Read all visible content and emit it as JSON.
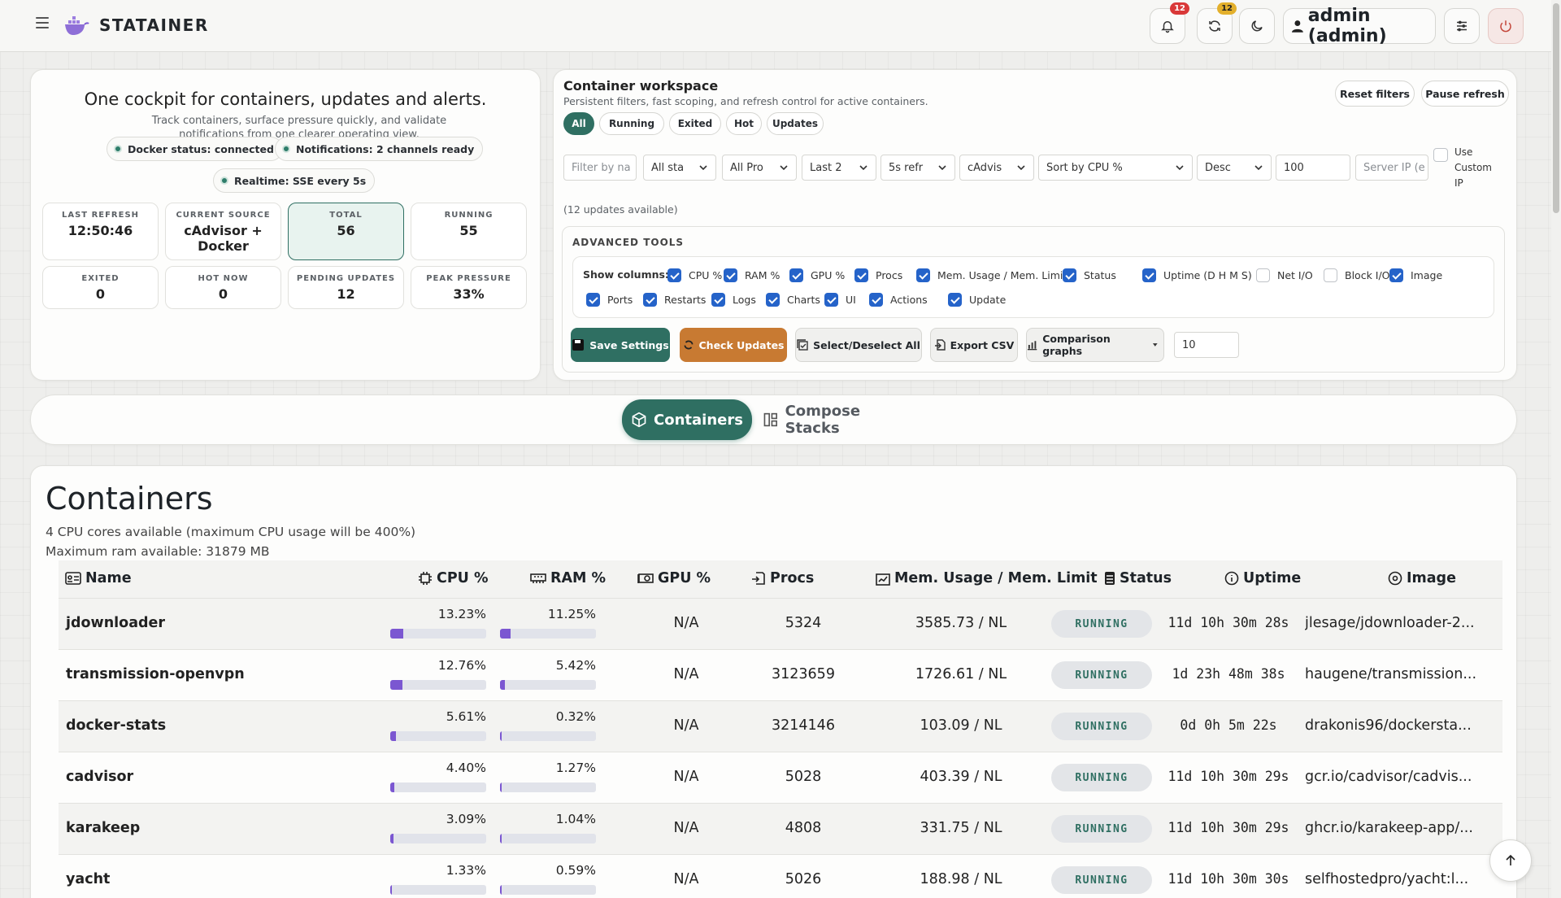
{
  "app": {
    "brand": "STATAINER",
    "notifications_count": "12",
    "updates_count": "12",
    "user_label": "admin (admin)"
  },
  "hero": {
    "title": "One cockpit for containers, updates and alerts.",
    "subtitle": "Track containers, surface pressure quickly, and validate notifications from one clearer operating view.",
    "pills": [
      "Docker status: connected",
      "Notifications: 2 channels ready",
      "Realtime: SSE every 5s"
    ],
    "stats": [
      {
        "label": "LAST REFRESH",
        "value": "12:50:46"
      },
      {
        "label": "CURRENT SOURCE",
        "value": "cAdvisor + Docker"
      },
      {
        "label": "TOTAL",
        "value": "56"
      },
      {
        "label": "RUNNING",
        "value": "55"
      },
      {
        "label": "EXITED",
        "value": "0"
      },
      {
        "label": "HOT NOW",
        "value": "0"
      },
      {
        "label": "PENDING UPDATES",
        "value": "12"
      },
      {
        "label": "PEAK PRESSURE",
        "value": "33%"
      }
    ]
  },
  "workspace": {
    "title": "Container workspace",
    "subtitle": "Persistent filters, fast scoping, and refresh control for active containers.",
    "reset_label": "Reset filters",
    "pause_label": "Pause refresh",
    "tabs": [
      "All",
      "Running",
      "Exited",
      "Hot",
      "Updates"
    ],
    "filter_placeholder": "Filter by na",
    "status_select": "All sta",
    "project_select": "All Pro",
    "time_select": "Last 2",
    "refresh_select": "5s refr",
    "source_select": "cAdvis",
    "sort_select": "Sort by CPU %",
    "order_select": "Desc",
    "limit_value": "100",
    "server_ip_placeholder": "Server IP (e",
    "custom_ip_label": "Use Custom IP",
    "updates_note": "(12 updates available)"
  },
  "advanced": {
    "title": "ADVANCED TOOLS",
    "show_columns_label": "Show columns:",
    "columns_row1": [
      {
        "label": "CPU %",
        "checked": true
      },
      {
        "label": "RAM %",
        "checked": true
      },
      {
        "label": "GPU %",
        "checked": true
      },
      {
        "label": "Procs",
        "checked": true
      },
      {
        "label": "Mem. Usage / Mem. Limit",
        "checked": true
      },
      {
        "label": "Status",
        "checked": true
      },
      {
        "label": "Uptime (D H M S)",
        "checked": true
      },
      {
        "label": "Net I/O",
        "checked": false
      },
      {
        "label": "Block I/O",
        "checked": false
      },
      {
        "label": "Image",
        "checked": true
      }
    ],
    "columns_row2": [
      {
        "label": "Ports",
        "checked": true
      },
      {
        "label": "Restarts",
        "checked": true
      },
      {
        "label": "Logs",
        "checked": true
      },
      {
        "label": "Charts",
        "checked": true
      },
      {
        "label": "UI",
        "checked": true
      },
      {
        "label": "Actions",
        "checked": true
      },
      {
        "label": "Update",
        "checked": true
      }
    ],
    "save_label": "Save Settings",
    "check_updates_label": "Check Updates",
    "select_all_label": "Select/Deselect All",
    "export_label": "Export CSV",
    "comparison_label": "Comparison graphs",
    "comparison_value": "10"
  },
  "switcher": {
    "containers_label": "Containers",
    "stacks_label": "Compose Stacks"
  },
  "containers": {
    "title": "Containers",
    "cpu_note": "4 CPU cores available (maximum CPU usage will be 400%)",
    "ram_note": "Maximum ram available: 31879 MB",
    "headers": [
      "Name",
      "CPU %",
      "RAM %",
      "GPU %",
      "Procs",
      "Mem. Usage / Mem. Limit",
      "Status",
      "Uptime",
      "Image"
    ],
    "rows": [
      {
        "name": "jdownloader",
        "cpu": "13.23%",
        "cpu_val": 13.23,
        "ram": "11.25%",
        "ram_val": 11.25,
        "gpu": "N/A",
        "procs": "5324",
        "mem": "3585.73 / NL",
        "status": "RUNNING",
        "uptime": "11d 10h 30m 28s",
        "image": "jlesage/jdownloader-2..."
      },
      {
        "name": "transmission-openvpn",
        "cpu": "12.76%",
        "cpu_val": 12.76,
        "ram": "5.42%",
        "ram_val": 5.42,
        "gpu": "N/A",
        "procs": "3123659",
        "mem": "1726.61 / NL",
        "status": "RUNNING",
        "uptime": "1d 23h 48m 38s",
        "image": "haugene/transmission..."
      },
      {
        "name": "docker-stats",
        "cpu": "5.61%",
        "cpu_val": 5.61,
        "ram": "0.32%",
        "ram_val": 0.32,
        "gpu": "N/A",
        "procs": "3214146",
        "mem": "103.09 / NL",
        "status": "RUNNING",
        "uptime": "0d 0h 5m 22s",
        "image": "drakonis96/dockersta..."
      },
      {
        "name": "cadvisor",
        "cpu": "4.40%",
        "cpu_val": 4.4,
        "ram": "1.27%",
        "ram_val": 1.27,
        "gpu": "N/A",
        "procs": "5028",
        "mem": "403.39 / NL",
        "status": "RUNNING",
        "uptime": "11d 10h 30m 29s",
        "image": "gcr.io/cadvisor/cadvis..."
      },
      {
        "name": "karakeep",
        "cpu": "3.09%",
        "cpu_val": 3.09,
        "ram": "1.04%",
        "ram_val": 1.04,
        "gpu": "N/A",
        "procs": "4808",
        "mem": "331.75 / NL",
        "status": "RUNNING",
        "uptime": "11d 10h 30m 29s",
        "image": "ghcr.io/karakeep-app/..."
      },
      {
        "name": "yacht",
        "cpu": "1.33%",
        "cpu_val": 1.33,
        "ram": "0.59%",
        "ram_val": 0.59,
        "gpu": "N/A",
        "procs": "5026",
        "mem": "188.98 / NL",
        "status": "RUNNING",
        "uptime": "11d 10h 30m 30s",
        "image": "selfhostedpro/yacht:l..."
      }
    ]
  },
  "colors": {
    "accent": "#2f6f62",
    "warning": "#c87a32",
    "bar_fill": "#7b57d1",
    "checkbox": "#2563c9",
    "badge_red": "#d93838",
    "badge_yellow": "#e3b02c"
  }
}
